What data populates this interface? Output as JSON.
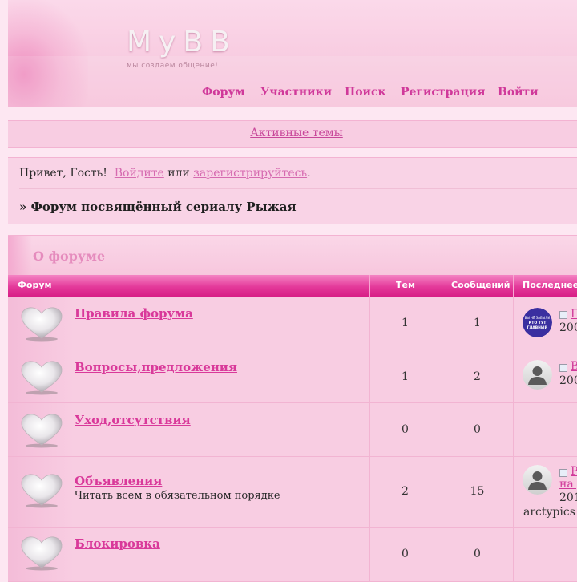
{
  "header": {
    "logo": "MyBB",
    "slogan": "мы создаем общение!",
    "nav": [
      {
        "label": "Форум"
      },
      {
        "label": "Участники"
      },
      {
        "label": "Поиск"
      },
      {
        "label": "Регистрация"
      },
      {
        "label": "Войти"
      }
    ]
  },
  "active_topics": "Активные темы",
  "greeting": {
    "hello": "Привет, Гость!",
    "login": "Войдите",
    "or": "или",
    "register": "зарегистрируйтесь",
    "period": ".",
    "breadcrumb": "» Форум посвящённый сериалу Рыжая"
  },
  "category": {
    "title": "О форуме",
    "columns": [
      "Форум",
      "Тем",
      "Сообщений",
      "Последнее"
    ]
  },
  "forums": [
    {
      "title": "Правила форума",
      "desc": "",
      "topics": "1",
      "posts": "1",
      "last_title": "П",
      "last_date": "200",
      "last_user": "",
      "avatar": "badge",
      "avatar_text": "ВЫ ЧЁ ЗАБЫЛИ КТО ТУТ ГЛАВНЫЙ"
    },
    {
      "title": "Вопросы,предложения",
      "desc": "",
      "topics": "1",
      "posts": "2",
      "last_title": "В",
      "last_date": "200",
      "last_user": "",
      "avatar": "user"
    },
    {
      "title": "Уход,отсутствия",
      "desc": "",
      "topics": "0",
      "posts": "0",
      "last_title": "",
      "last_date": "",
      "last_user": "",
      "avatar": "none"
    },
    {
      "title": "Объявления",
      "desc": "Читать всем в обязательном порядке",
      "topics": "2",
      "posts": "15",
      "last_title": "Р",
      "last_title2": "на д",
      "last_date": "201",
      "last_user": "arctypics",
      "avatar": "user"
    },
    {
      "title": "Блокировка",
      "desc": "",
      "topics": "0",
      "posts": "0",
      "last_title": "",
      "last_date": "",
      "last_user": "",
      "avatar": "none"
    }
  ]
}
